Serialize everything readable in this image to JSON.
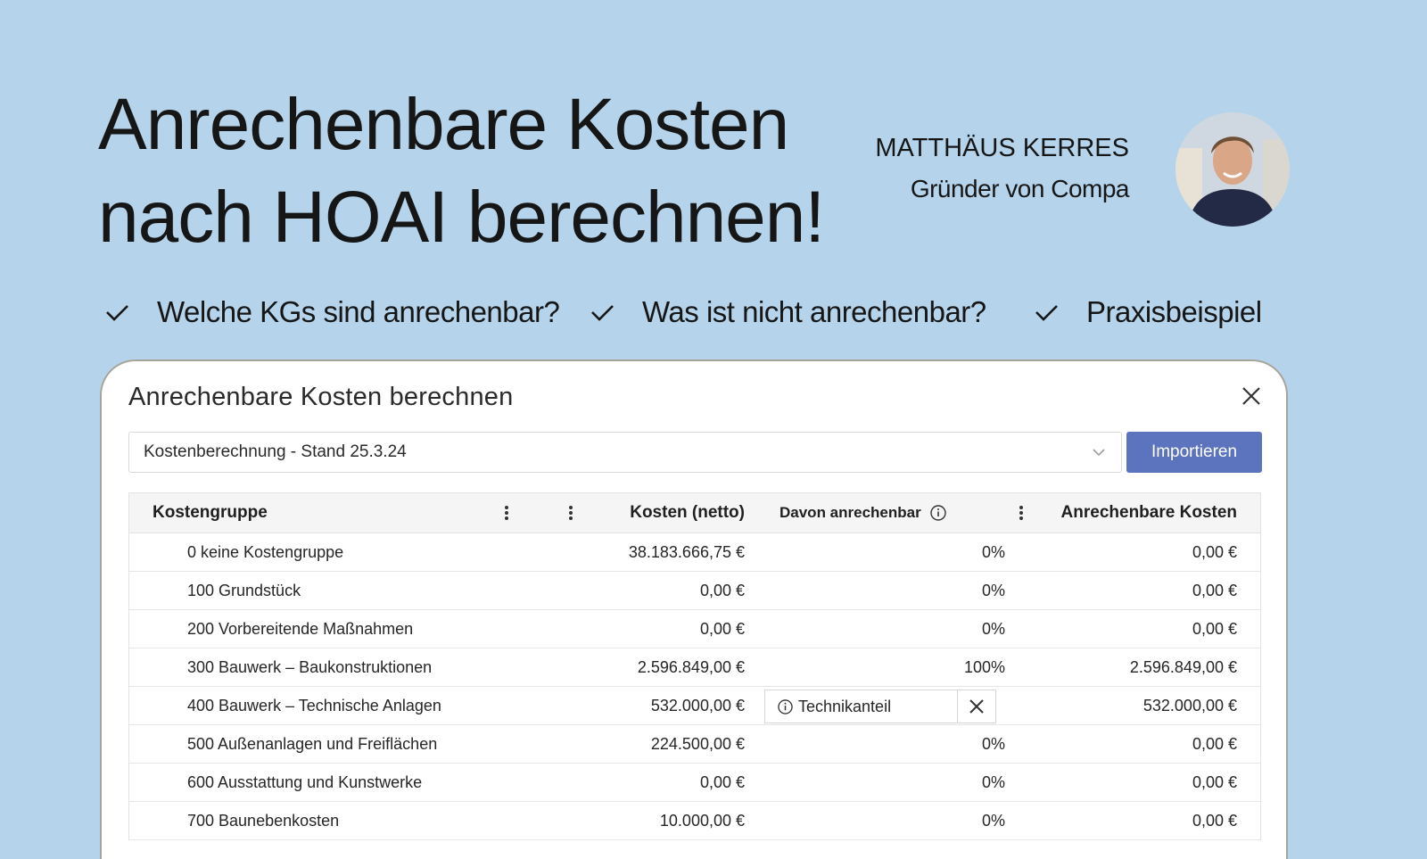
{
  "headline": {
    "line1": "Anrechenbare Kosten",
    "line2": "nach HOAI berechnen!"
  },
  "author": {
    "name": "MATTHÄUS KERRES",
    "role": "Gründer von Compa"
  },
  "features": [
    "Welche KGs sind anrechenbar?",
    "Was ist nicht anrechenbar?",
    "Praxisbeispiel"
  ],
  "dialog": {
    "title": "Anrechenbare Kosten berechnen",
    "select_value": "Kostenberechnung - Stand 25.3.24",
    "import_label": "Importieren",
    "columns": {
      "kostengruppe": "Kostengruppe",
      "kosten": "Kosten (netto)",
      "davon": "Davon anrechenbar",
      "anrechenbar": "Anrechenbare Kosten"
    },
    "rows": [
      {
        "kg": "0 keine Kostengruppe",
        "kosten": "38.183.666,75 €",
        "pct": "0%",
        "anr": "0,00 €"
      },
      {
        "kg": "100 Grundstück",
        "kosten": "0,00 €",
        "pct": "0%",
        "anr": "0,00 €"
      },
      {
        "kg": "200 Vorbereitende Maßnahmen",
        "kosten": "0,00 €",
        "pct": "0%",
        "anr": "0,00 €"
      },
      {
        "kg": "300 Bauwerk – Baukonstruktionen",
        "kosten": "2.596.849,00 €",
        "pct": "100%",
        "anr": "2.596.849,00 €"
      },
      {
        "kg": "400 Bauwerk – Technische Anlagen",
        "kosten": "532.000,00 €",
        "tag": "Technikanteil",
        "anr": "532.000,00 €"
      },
      {
        "kg": "500 Außenanlagen und Freiflächen",
        "kosten": "224.500,00 €",
        "pct": "0%",
        "anr": "0,00 €"
      },
      {
        "kg": "600 Ausstattung und Kunstwerke",
        "kosten": "0,00 €",
        "pct": "0%",
        "anr": "0,00 €"
      },
      {
        "kg": "700 Baunebenkosten",
        "kosten": "10.000,00 €",
        "pct": "0%",
        "anr": "0,00 €"
      }
    ]
  },
  "colors": {
    "background": "#b5d4ec",
    "button": "#5c74bd"
  }
}
